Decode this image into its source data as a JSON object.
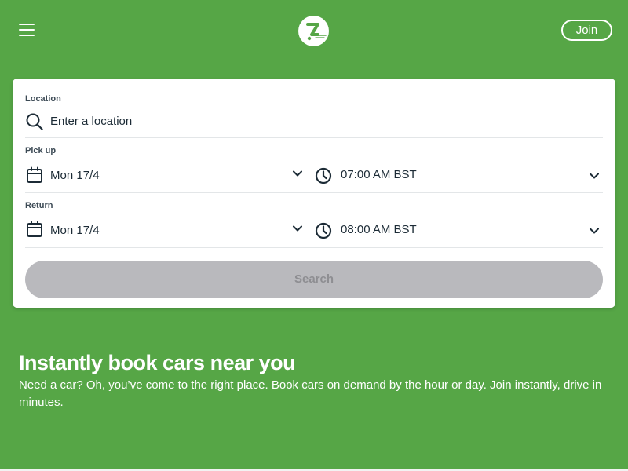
{
  "header": {
    "menu_icon": "hamburger-menu-icon",
    "logo_icon": "zipcar-z-logo",
    "join_label": "Join"
  },
  "search_form": {
    "location": {
      "label": "Location",
      "placeholder": "Enter a location",
      "icon": "search-icon"
    },
    "pickup": {
      "label": "Pick up",
      "date": "Mon 17/4",
      "time": "07:00 AM BST"
    },
    "return": {
      "label": "Return",
      "date": "Mon 17/4",
      "time": "08:00 AM BST"
    },
    "search_label": "Search"
  },
  "hero": {
    "title": "Instantly book cars near you",
    "description": "Need a car? Oh, you’ve come to the right place. Book cars on demand by the hour or day. Join instantly, drive in minutes."
  },
  "colors": {
    "brand_green": "#56a646",
    "button_disabled": "#b9b9bd",
    "text_dark": "#1c2b36"
  }
}
